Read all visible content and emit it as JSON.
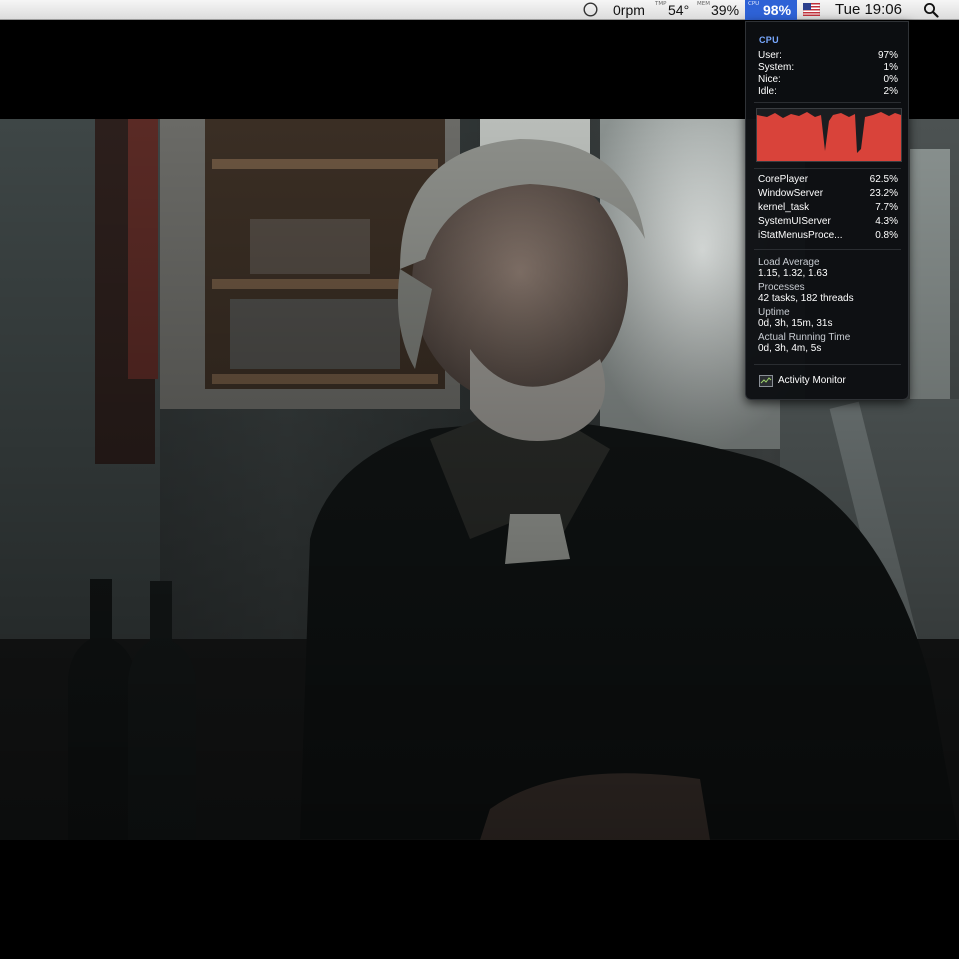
{
  "menubar": {
    "fan_rpm": "0rpm",
    "temp_tag": "TMP",
    "temp_value": "54°",
    "mem_tag": "MEM",
    "mem_value": "39%",
    "cpu_tag": "CPU",
    "cpu_value": "98%",
    "clock": "Tue 19:06"
  },
  "cpu_popup": {
    "header": "CPU",
    "usage": [
      {
        "label": "User:",
        "value": "97%"
      },
      {
        "label": "System:",
        "value": "1%"
      },
      {
        "label": "Nice:",
        "value": "0%"
      },
      {
        "label": "Idle:",
        "value": "2%"
      }
    ],
    "processes": [
      {
        "name": "CorePlayer",
        "value": "62.5%"
      },
      {
        "name": "WindowServer",
        "value": "23.2%"
      },
      {
        "name": "kernel_task",
        "value": "7.7%"
      },
      {
        "name": "SystemUIServer",
        "value": "4.3%"
      },
      {
        "name": "iStatMenusProce...",
        "value": "0.8%"
      }
    ],
    "load_average_label": "Load Average",
    "load_average_value": "1.15, 1.32, 1.63",
    "processes_label": "Processes",
    "processes_value": "42 tasks, 182 threads",
    "uptime_label": "Uptime",
    "uptime_value": "0d, 3h, 15m, 31s",
    "running_time_label": "Actual Running Time",
    "running_time_value": "0d, 3h, 4m, 5s",
    "activity_monitor_label": "Activity Monitor",
    "graph_color": "#d9433a"
  },
  "colors": {
    "accent": "#2e62d6",
    "header_blue": "#78a8ff"
  }
}
